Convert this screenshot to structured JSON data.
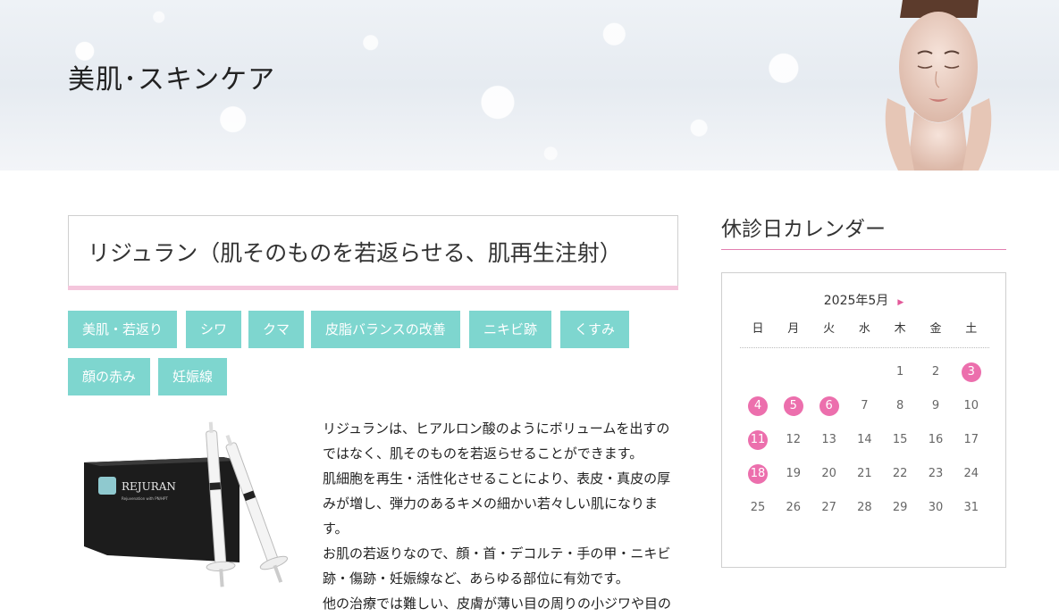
{
  "hero": {
    "title": "美肌･スキンケア"
  },
  "article": {
    "title": "リジュラン（肌そのものを若返らせる、肌再生注射）",
    "tags": [
      "美肌・若返り",
      "シワ",
      "クマ",
      "皮脂バランスの改善",
      "ニキビ跡",
      "くすみ",
      "顔の赤み",
      "妊娠線"
    ],
    "product_image": {
      "brand": "REJURAN",
      "sublabel": "Rejuvenation with PN/HPT"
    },
    "paragraphs": [
      "リジュランは、ヒアルロン酸のようにボリュームを出すのではなく、肌そのものを若返らせることができます。",
      "肌細胞を再生・活性化させることにより、表皮・真皮の厚みが増し、弾力のあるキメの細かい若々しい肌になります。",
      "お肌の若返りなので、顔・首・デコルテ・手の甲・ニキビ跡・傷跡・妊娠線など、あらゆる部位に有効です。",
      "他の治療では難しい、皮膚が薄い目の周りの小ジワや目の"
    ]
  },
  "sidebar": {
    "title": "休診日カレンダー",
    "calendar": {
      "month_label": "2025年5月",
      "next_icon": "next-month-arrow",
      "weekdays": [
        "日",
        "月",
        "火",
        "水",
        "木",
        "金",
        "土"
      ],
      "weeks": [
        [
          "",
          "",
          "",
          "",
          "1",
          "2",
          "3"
        ],
        [
          "4",
          "5",
          "6",
          "7",
          "8",
          "9",
          "10"
        ],
        [
          "11",
          "12",
          "13",
          "14",
          "15",
          "16",
          "17"
        ],
        [
          "18",
          "19",
          "20",
          "21",
          "22",
          "23",
          "24"
        ],
        [
          "25",
          "26",
          "27",
          "28",
          "29",
          "30",
          "31"
        ]
      ],
      "closed_days": [
        "3",
        "4",
        "5",
        "6",
        "11",
        "18"
      ],
      "closed_color": "#ec6fad"
    }
  },
  "colors": {
    "tag_bg": "#7ed6cf",
    "title_underline": "#f4c6dc",
    "accent": "#e3599a"
  }
}
